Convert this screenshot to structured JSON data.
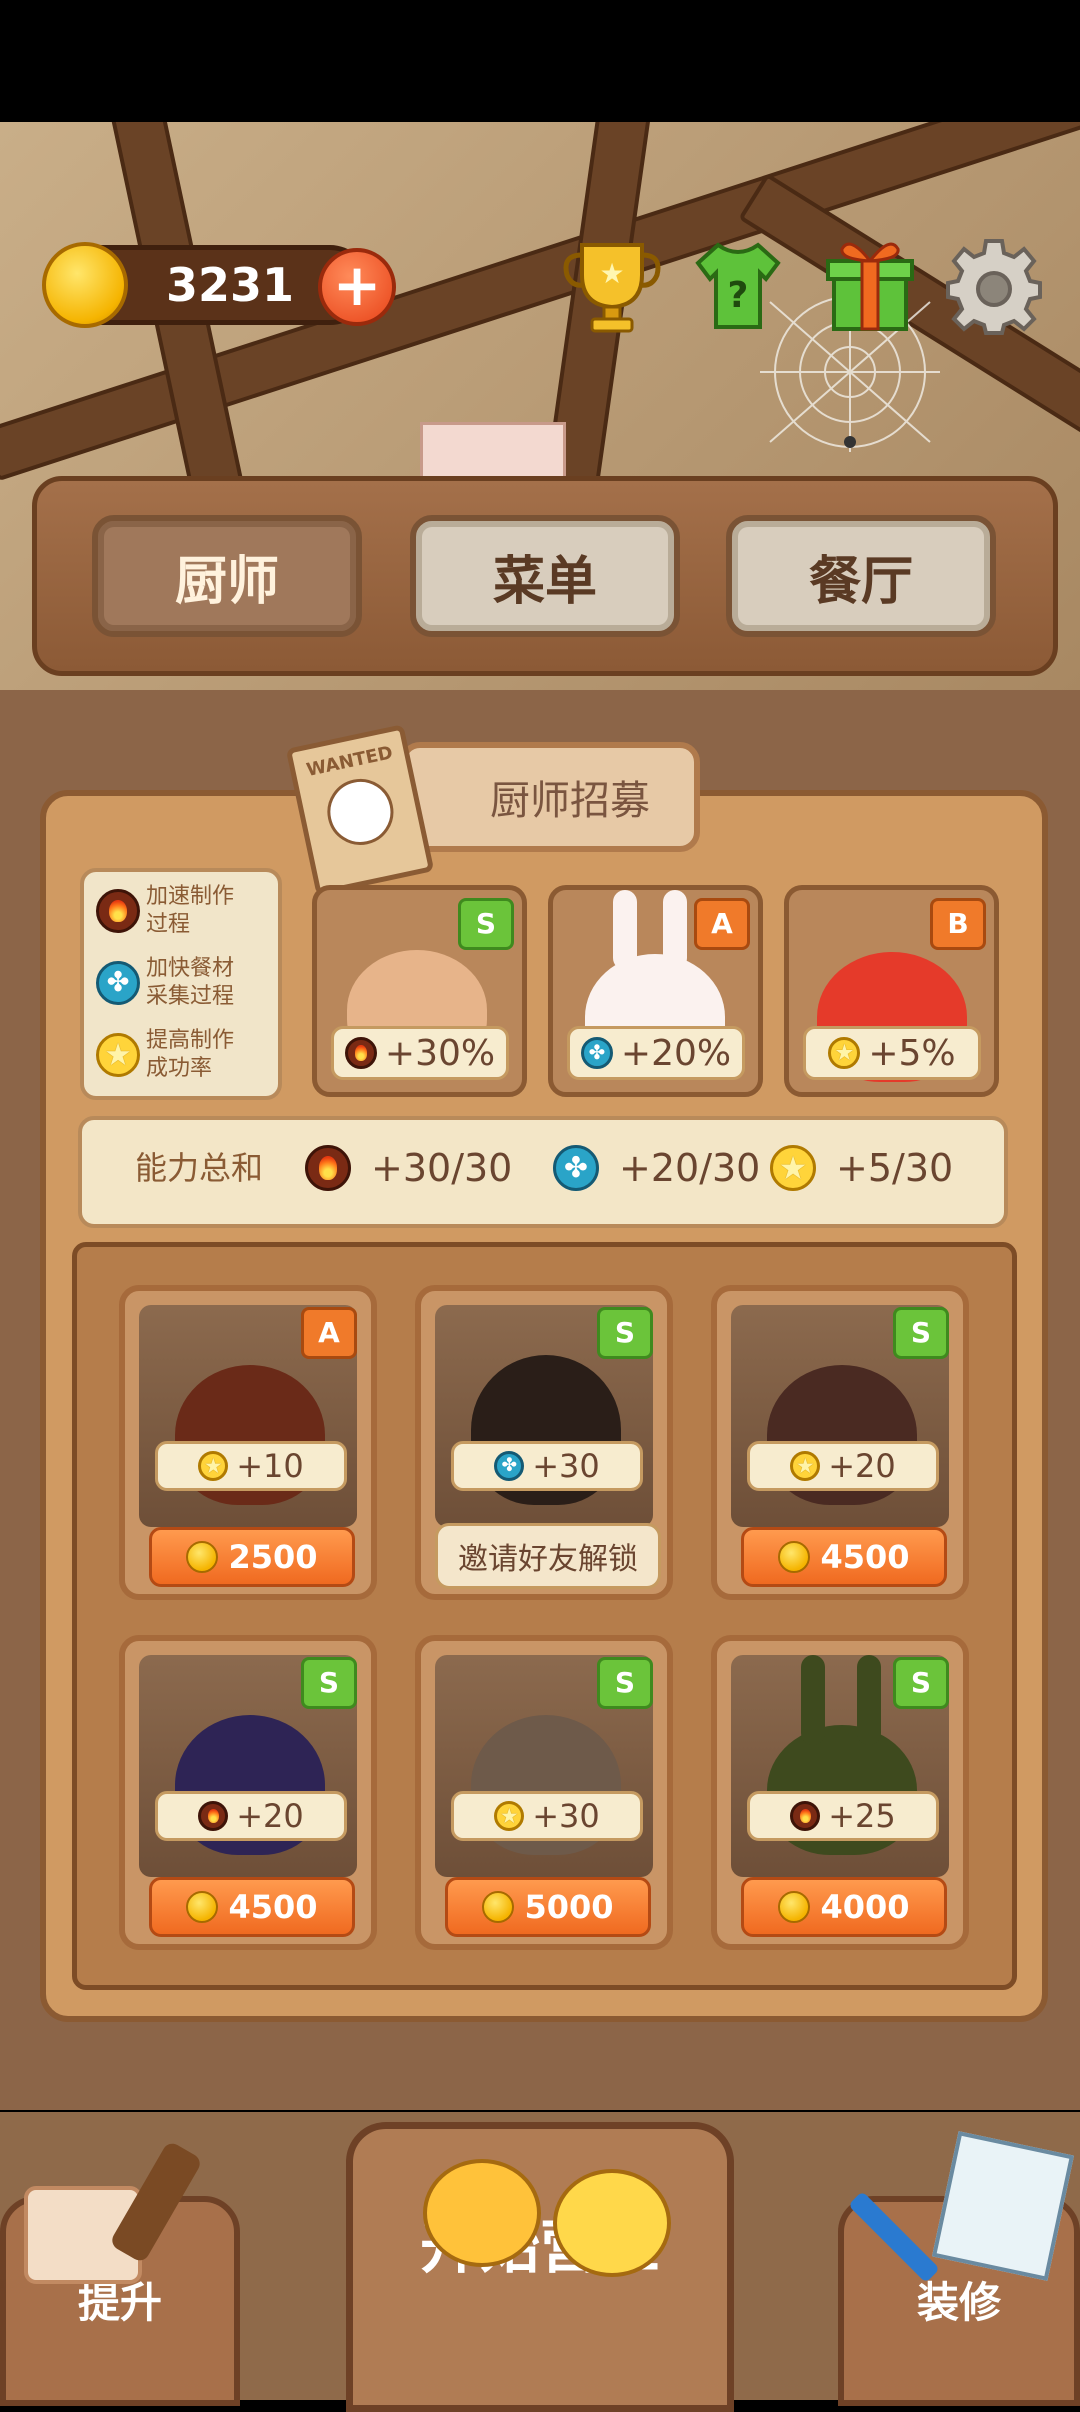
{
  "currency": {
    "coins": "3231",
    "add_label": "+"
  },
  "top_icons": [
    "trophy-icon",
    "mystery-shirt-icon",
    "gift-icon",
    "settings-gear-icon"
  ],
  "nav": {
    "tabs": [
      {
        "label": "厨师",
        "active": true
      },
      {
        "label": "菜单",
        "active": false
      },
      {
        "label": "餐厅",
        "active": false
      }
    ]
  },
  "recruit": {
    "title": "厨师招募",
    "wanted_text": "WANTED",
    "legend": [
      {
        "icon": "fire",
        "text1": "加速制作",
        "text2": "过程"
      },
      {
        "icon": "fan",
        "text1": "加快餐材",
        "text2": "采集过程"
      },
      {
        "icon": "star",
        "text1": "提高制作",
        "text2": "成功率"
      }
    ],
    "selected": [
      {
        "rank": "S",
        "icon": "fire",
        "bonus": "+30%"
      },
      {
        "rank": "A",
        "icon": "fan",
        "bonus": "+20%"
      },
      {
        "rank": "B",
        "icon": "star",
        "bonus": "+5%"
      }
    ],
    "total": {
      "label": "能力总和",
      "items": [
        {
          "icon": "fire",
          "value": "+30/30"
        },
        {
          "icon": "fan",
          "value": "+20/30"
        },
        {
          "icon": "star",
          "value": "+5/30"
        }
      ]
    }
  },
  "chefs": [
    {
      "rank": "A",
      "icon": "star",
      "bonus": "+10",
      "price": "2500"
    },
    {
      "rank": "S",
      "icon": "fan",
      "bonus": "+30",
      "action": "邀请好友解锁"
    },
    {
      "rank": "S",
      "icon": "star",
      "bonus": "+20",
      "price": "4500"
    },
    {
      "rank": "S",
      "icon": "fire",
      "bonus": "+20",
      "price": "4500"
    },
    {
      "rank": "S",
      "icon": "star",
      "bonus": "+30",
      "price": "5000"
    },
    {
      "rank": "S",
      "icon": "fire",
      "bonus": "+25",
      "price": "4000"
    }
  ],
  "bottom": {
    "upgrade_label": "提升",
    "start_label": "开始营业",
    "decorate_label": "装修"
  },
  "colors": {
    "wood_dark": "#6a4326",
    "accent_orange": "#f06a20",
    "rank_s_green": "#6bc43a"
  }
}
